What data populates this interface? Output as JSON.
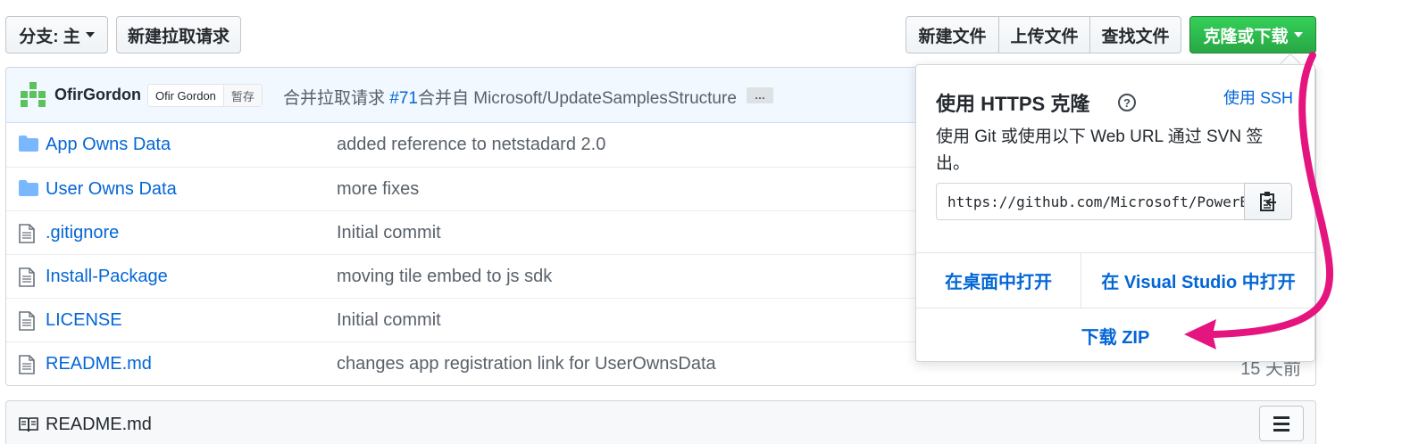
{
  "toolbar": {
    "branch_label": "分支: 主",
    "new_pr": "新建拉取请求",
    "new_file": "新建文件",
    "upload_files": "上传文件",
    "find_file": "查找文件",
    "clone_download": "克隆或下载",
    "clone_color": "#2ea44f"
  },
  "commit": {
    "author": "OfirGordon",
    "badge_name": "Ofir Gordon",
    "badge_status": "暂存",
    "message_prefix": "合并拉取请求 ",
    "pr_number": "#71",
    "message_suffix": "合并自 Microsoft/UpdateSamplesStructure",
    "ellipsis": "…"
  },
  "files": [
    {
      "name": "App Owns Data",
      "type": "folder",
      "message": "added reference to netstadard 2.0",
      "age": ""
    },
    {
      "name": "User Owns Data",
      "type": "folder",
      "message": "more fixes",
      "age": ""
    },
    {
      "name": ".gitignore",
      "type": "file",
      "message": "Initial commit",
      "age": ""
    },
    {
      "name": "Install-Package",
      "type": "file",
      "message": "moving tile embed to js sdk",
      "age": ""
    },
    {
      "name": "LICENSE",
      "type": "file",
      "message": "Initial commit",
      "age": ""
    },
    {
      "name": "README.md",
      "type": "file",
      "message": "changes app registration link for UserOwnsData",
      "age": "15 天前"
    }
  ],
  "readme": {
    "title": "README.md"
  },
  "clone_dropdown": {
    "title": "使用 HTTPS 克隆",
    "use_ssh": "使用 SSH",
    "description": "使用 Git 或使用以下 Web URL 通过 SVN 签出。",
    "url": "https://github.com/Microsoft/PowerBI-Developer-Samples.git",
    "open_desktop": "在桌面中打开",
    "open_vs": "在 Visual Studio 中打开",
    "download_zip": "下载 ZIP"
  },
  "annotation_color": "#e5157f"
}
